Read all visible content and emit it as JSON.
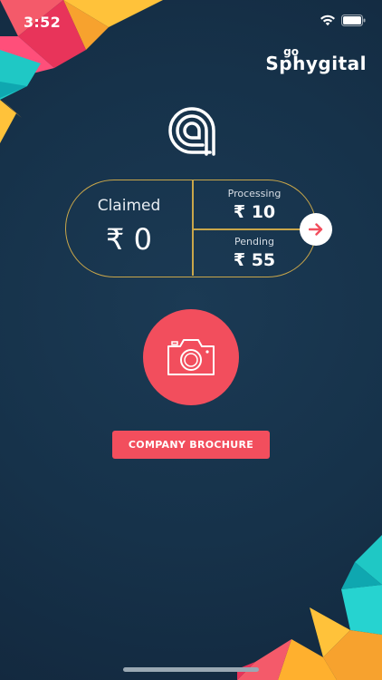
{
  "status_bar": {
    "time": "3:52",
    "wifi_icon": "wifi-icon",
    "battery_icon": "battery-icon"
  },
  "brand": {
    "prefix": "go",
    "name": "Sphygital"
  },
  "app_logo_icon": "a-logo-icon",
  "summary": {
    "claimed_label": "Claimed",
    "claimed_value": "₹ 0",
    "processing_label": "Processing",
    "processing_value": "₹ 10",
    "pending_label": "Pending",
    "pending_value": "₹ 55",
    "arrow_icon": "arrow-right-icon"
  },
  "camera": {
    "icon": "camera-icon"
  },
  "brochure_button_label": "COMPANY BROCHURE",
  "colors": {
    "background": "#16324a",
    "accent": "#f24e5d",
    "pill_border": "#c9a64a"
  }
}
